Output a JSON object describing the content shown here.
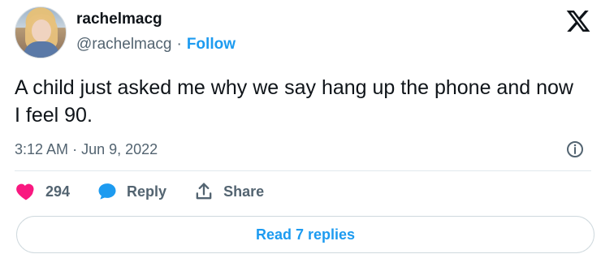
{
  "author": {
    "display_name": "rachelmacg",
    "handle": "@rachelmacg",
    "separator": "·",
    "follow_label": "Follow"
  },
  "tweet": {
    "text": "A child just asked me why we say hang up the phone and now I feel 90.",
    "time": "3:12 AM",
    "meta_separator": "·",
    "date": "Jun 9, 2022"
  },
  "actions": {
    "likes_count": "294",
    "reply_label": "Reply",
    "share_label": "Share"
  },
  "footer": {
    "read_replies_label": "Read 7 replies"
  },
  "colors": {
    "accent": "#1d9bf0",
    "like": "#f91880",
    "text": "#0f1419",
    "secondary": "#536471"
  },
  "icons": {
    "logo": "x-logo-icon",
    "info": "info-icon",
    "like": "heart-icon",
    "reply": "speech-bubble-icon",
    "share": "share-upload-icon"
  }
}
